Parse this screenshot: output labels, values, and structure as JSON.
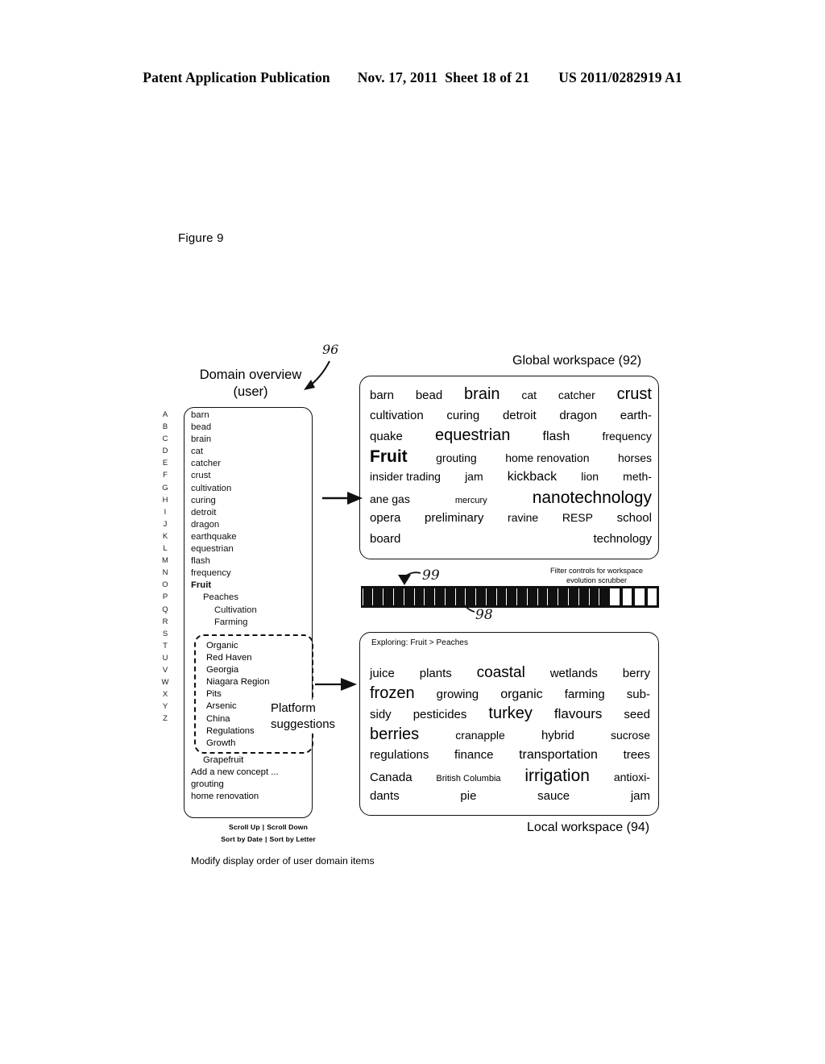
{
  "patent_header": {
    "publication": "Patent Application Publication",
    "date": "Nov. 17, 2011",
    "sheet": "Sheet 18 of 21",
    "number": "US 2011/0282919 A1"
  },
  "figure": {
    "label": "Figure 9"
  },
  "annotations": {
    "ref_96": "96",
    "ref_98": "98",
    "ref_99": "99"
  },
  "domain_overview": {
    "title_line1": "Domain overview",
    "title_line2": "(user)",
    "alphabet": [
      "A",
      "B",
      "C",
      "D",
      "E",
      "F",
      "G",
      "H",
      "I",
      "J",
      "K",
      "L",
      "M",
      "N",
      "O",
      "P",
      "Q",
      "R",
      "S",
      "T",
      "U",
      "V",
      "W",
      "X",
      "Y",
      "Z"
    ],
    "items": [
      {
        "label": "barn",
        "level": 0,
        "bold": false
      },
      {
        "label": "bead",
        "level": 0,
        "bold": false
      },
      {
        "label": "brain",
        "level": 0,
        "bold": false
      },
      {
        "label": "cat",
        "level": 0,
        "bold": false
      },
      {
        "label": "catcher",
        "level": 0,
        "bold": false
      },
      {
        "label": "crust",
        "level": 0,
        "bold": false
      },
      {
        "label": "cultivation",
        "level": 0,
        "bold": false
      },
      {
        "label": "curing",
        "level": 0,
        "bold": false
      },
      {
        "label": "detroit",
        "level": 0,
        "bold": false
      },
      {
        "label": "dragon",
        "level": 0,
        "bold": false
      },
      {
        "label": "earthquake",
        "level": 0,
        "bold": false
      },
      {
        "label": "equestrian",
        "level": 0,
        "bold": false
      },
      {
        "label": "flash",
        "level": 0,
        "bold": false
      },
      {
        "label": "frequency",
        "level": 0,
        "bold": false
      },
      {
        "label": "Fruit",
        "level": 0,
        "bold": true
      },
      {
        "label": "Peaches",
        "level": 1,
        "bold": false
      },
      {
        "label": "Cultivation",
        "level": 2,
        "bold": false
      },
      {
        "label": "Farming",
        "level": 2,
        "bold": false
      }
    ],
    "platform_suggestions": {
      "label_line1": "Platform",
      "label_line2": "suggestions",
      "items": [
        "Organic",
        "Red Haven",
        "Georgia",
        "Niagara Region",
        "Pits",
        "Arsenic",
        "China",
        "Regulations",
        "Growth"
      ]
    },
    "tail_items": [
      {
        "label": "Grapefruit",
        "level": 1
      },
      {
        "label": "Add a new concept ...",
        "level": 0
      },
      {
        "label": "grouting",
        "level": 0
      },
      {
        "label": "home renovation",
        "level": 0
      }
    ],
    "controls": {
      "scroll_up": "Scroll Up",
      "scroll_down": "Scroll Down",
      "sort_by_date": "Sort by Date",
      "sort_by_letter": "Sort by Letter",
      "separator": "|"
    },
    "caption": "Modify display order of user domain items"
  },
  "global_workspace": {
    "label": "Global workspace (92)",
    "lines": [
      [
        {
          "text": "barn",
          "size": 15
        },
        {
          "text": "bead",
          "size": 15
        },
        {
          "text": "brain",
          "size": 20
        },
        {
          "text": "cat",
          "size": 14
        },
        {
          "text": "catcher",
          "size": 14
        },
        {
          "text": "crust",
          "size": 20
        }
      ],
      [
        {
          "text": "cultivation",
          "size": 15
        },
        {
          "text": "curing",
          "size": 15
        },
        {
          "text": "detroit",
          "size": 15
        },
        {
          "text": "dragon",
          "size": 15
        },
        {
          "text": "earth-",
          "size": 15
        }
      ],
      [
        {
          "text": "quake",
          "size": 15
        },
        {
          "text": "equestrian",
          "size": 20
        },
        {
          "text": "flash",
          "size": 16
        },
        {
          "text": "frequency",
          "size": 14
        }
      ],
      [
        {
          "text": "Fruit",
          "size": 21,
          "bold": true
        },
        {
          "text": "grouting",
          "size": 14
        },
        {
          "text": "home renovation",
          "size": 14
        },
        {
          "text": "horses",
          "size": 14
        }
      ],
      [
        {
          "text": "insider trading",
          "size": 14
        },
        {
          "text": "jam",
          "size": 14
        },
        {
          "text": "kickback",
          "size": 16
        },
        {
          "text": "lion",
          "size": 14
        },
        {
          "text": "meth-",
          "size": 14
        }
      ],
      [
        {
          "text": "ane gas",
          "size": 14
        },
        {
          "text": "mercury",
          "size": 11
        },
        {
          "text": "nanotechnology",
          "size": 21
        }
      ],
      [
        {
          "text": "opera",
          "size": 15
        },
        {
          "text": "preliminary",
          "size": 15
        },
        {
          "text": "ravine",
          "size": 14
        },
        {
          "text": "RESP",
          "size": 14
        },
        {
          "text": "school",
          "size": 15
        }
      ],
      [
        {
          "text": "board",
          "size": 15
        },
        {
          "text": "technology",
          "size": 15
        }
      ]
    ]
  },
  "scrubber": {
    "filter_label_line1": "Filter controls for workspace",
    "filter_label_line2": "evolution scrubber",
    "total_segments": 28,
    "filled_segments": 24,
    "empty_segments": 4,
    "playhead_index": 5
  },
  "local_workspace": {
    "label": "Local workspace (94)",
    "breadcrumb": "Exploring: Fruit > Peaches",
    "lines": [
      [
        {
          "text": "juice",
          "size": 15
        },
        {
          "text": "plants",
          "size": 15
        },
        {
          "text": "coastal",
          "size": 19
        },
        {
          "text": "wetlands",
          "size": 15
        },
        {
          "text": "berry",
          "size": 15
        }
      ],
      [
        {
          "text": "frozen",
          "size": 20
        },
        {
          "text": "growing",
          "size": 15
        },
        {
          "text": "organic",
          "size": 16
        },
        {
          "text": "farming",
          "size": 15
        },
        {
          "text": "sub-",
          "size": 15
        }
      ],
      [
        {
          "text": "sidy",
          "size": 15
        },
        {
          "text": "pesticides",
          "size": 15
        },
        {
          "text": "turkey",
          "size": 20
        },
        {
          "text": "flavours",
          "size": 17
        },
        {
          "text": "seed",
          "size": 15
        }
      ],
      [
        {
          "text": "berries",
          "size": 20
        },
        {
          "text": "cranapple",
          "size": 14
        },
        {
          "text": "hybrid",
          "size": 15
        },
        {
          "text": "sucrose",
          "size": 14
        }
      ],
      [
        {
          "text": "regulations",
          "size": 15
        },
        {
          "text": "finance",
          "size": 15
        },
        {
          "text": "transportation",
          "size": 16
        },
        {
          "text": "trees",
          "size": 15
        }
      ],
      [
        {
          "text": "Canada",
          "size": 15
        },
        {
          "text": "British Columbia",
          "size": 11
        },
        {
          "text": "irrigation",
          "size": 21
        },
        {
          "text": "antioxi-",
          "size": 14
        }
      ],
      [
        {
          "text": "dants",
          "size": 15
        },
        {
          "text": "pie",
          "size": 15
        },
        {
          "text": "sauce",
          "size": 15
        },
        {
          "text": "jam",
          "size": 15
        }
      ]
    ]
  }
}
